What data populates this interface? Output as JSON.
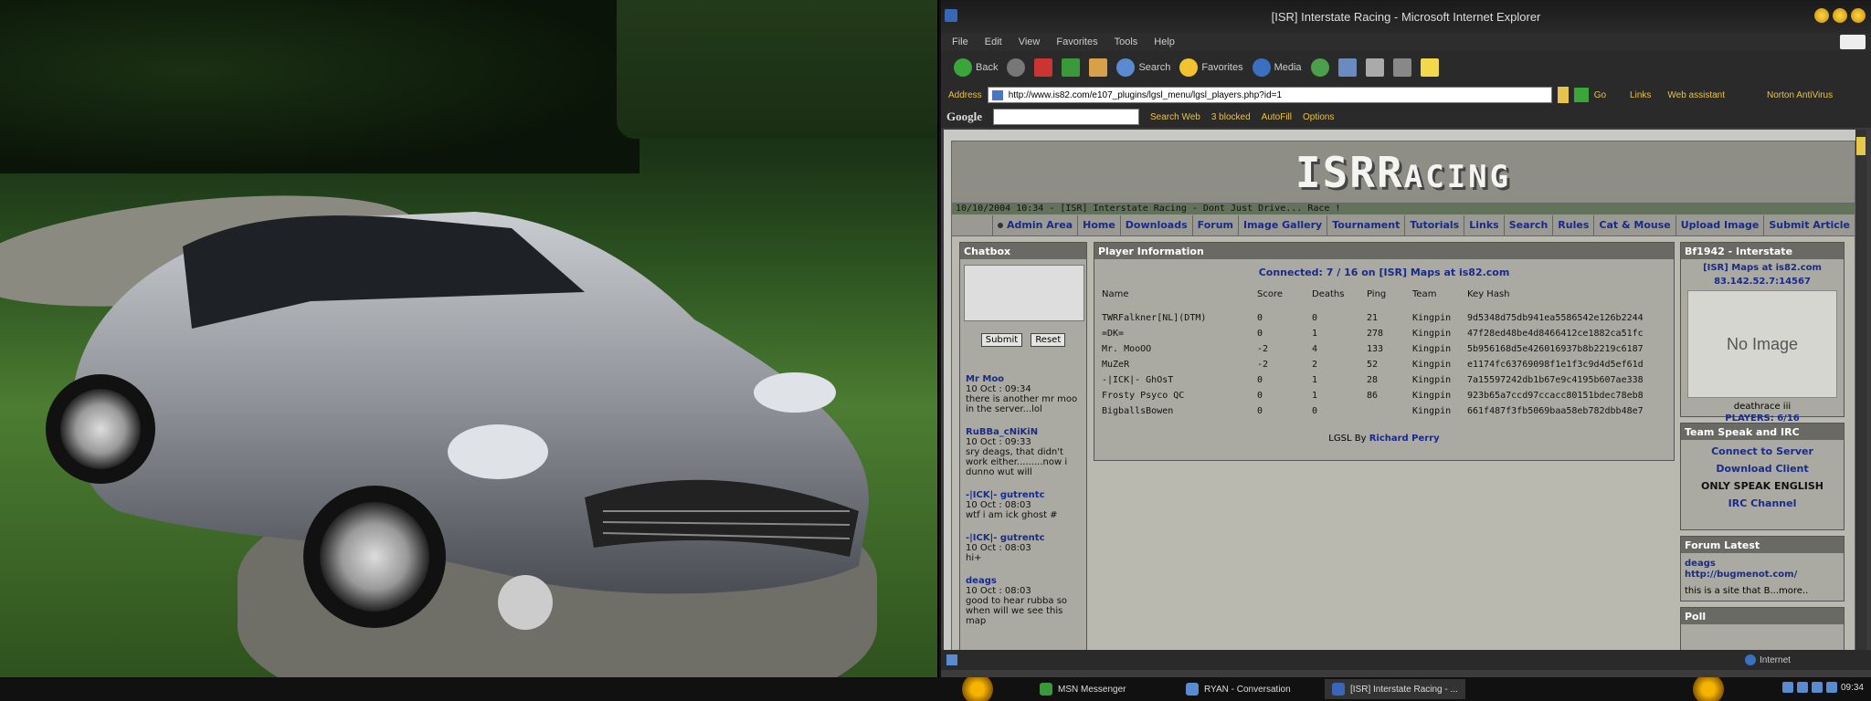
{
  "window": {
    "title": "[ISR] Interstate Racing - Microsoft Internet Explorer"
  },
  "menu": [
    "File",
    "Edit",
    "View",
    "Favorites",
    "Tools",
    "Help"
  ],
  "toolbar": {
    "back": "Back",
    "search": "Search",
    "favorites": "Favorites",
    "media": "Media"
  },
  "address": {
    "label": "Address",
    "url": "http://www.is82.com/e107_plugins/lgsl_menu/lgsl_players.php?id=1",
    "go": "Go",
    "links": "Links",
    "assistant": "Web assistant",
    "norton": "Norton AntiVirus"
  },
  "google": {
    "logo": "Google",
    "search": "Search Web",
    "blocked": "3 blocked",
    "autofill": "AutoFill",
    "options": "Options"
  },
  "site": {
    "logo_isr": "ISR",
    "logo_racing": "ACING",
    "logo_r": "R",
    "strip": "10/10/2004 10:34 - [ISR] Interstate Racing - Dont Just Drive... Race !",
    "nav": [
      "Admin Area",
      "Home",
      "Downloads",
      "Forum",
      "Image Gallery",
      "Tournament",
      "Tutorials",
      "Links",
      "Search",
      "Rules",
      "Cat & Mouse",
      "Upload Image",
      "Submit Article"
    ]
  },
  "chatbox": {
    "title": "Chatbox",
    "submit": "Submit",
    "reset": "Reset",
    "messages": [
      {
        "user": "Mr Moo",
        "time": "10 Oct : 09:34",
        "text": "there is another mr moo in the server...lol"
      },
      {
        "user": "RuBBa_cNiKiN",
        "time": "10 Oct : 09:33",
        "text": "sry deags, that didn't work either.........now i dunno wut will"
      },
      {
        "user": "-|ICK|- gutrentc",
        "time": "10 Oct : 08:03",
        "text": "wtf i am ick ghost #"
      },
      {
        "user": "-|ICK|- gutrentc",
        "time": "10 Oct : 08:03",
        "text": "hi+"
      },
      {
        "user": "deags",
        "time": "10 Oct : 08:03",
        "text": "good to hear rubba so when will we see this map"
      }
    ]
  },
  "player_info": {
    "title": "Player Information",
    "connected": "Connected: 7 / 16 on [ISR] Maps at is82.com",
    "headers": [
      "Name",
      "Score",
      "Deaths",
      "Ping",
      "Team",
      "Key Hash"
    ],
    "rows": [
      [
        "TWRFalkner[NL](DTM)",
        "0",
        "0",
        "21",
        "Kingpin",
        "9d5348d75db941ea5586542e126b2244"
      ],
      [
        "=DK=",
        "0",
        "1",
        "278",
        "Kingpin",
        "47f28ed48be4d8466412ce1882ca51fc"
      ],
      [
        "Mr. MooOO",
        "-2",
        "4",
        "133",
        "Kingpin",
        "5b956168d5e426016937b8b2219c6187"
      ],
      [
        "MuZeR",
        "-2",
        "2",
        "52",
        "Kingpin",
        "e1174fc63769098f1e1f3c9d4d5ef61d"
      ],
      [
        "-|ICK|- GhOsT",
        "0",
        "1",
        "28",
        "Kingpin",
        "7a15597242db1b67e9c4195b607ae338"
      ],
      [
        "Frosty Psyco QC",
        "0",
        "1",
        "86",
        "Kingpin",
        "923b65a7ccd97ccacc80151bdec78eb8"
      ],
      [
        "BigballsBowen",
        "0",
        "0",
        "",
        "Kingpin",
        "661f487f3fb5069baa58eb782dbb48e7"
      ]
    ],
    "credit_prefix": "LGSL By",
    "credit_name": "Richard Perry"
  },
  "bf1942": {
    "title": "Bf1942 - Interstate",
    "server": "[ISR] Maps at is82.com",
    "ip": "83.142.52.7:14567",
    "no_image": "No Image",
    "map": "deathrace iii",
    "players": "PLAYERS: 6/16"
  },
  "teamspeak": {
    "title": "Team Speak and IRC",
    "connect": "Connect to Server",
    "download": "Download Client",
    "english": "ONLY SPEAK ENGLISH",
    "irc": "IRC Channel"
  },
  "forum": {
    "title": "Forum Latest",
    "user": "deags",
    "link": "http://bugmenot.com/",
    "text": "this is a site that B...more.."
  },
  "poll": {
    "title": "Poll"
  },
  "statusbar": {
    "zone": "Internet"
  },
  "taskbar": {
    "items": [
      "MSN Messenger",
      "RYAN - Conversation",
      "[ISR] Interstate Racing - ..."
    ],
    "clock": "09:34"
  }
}
